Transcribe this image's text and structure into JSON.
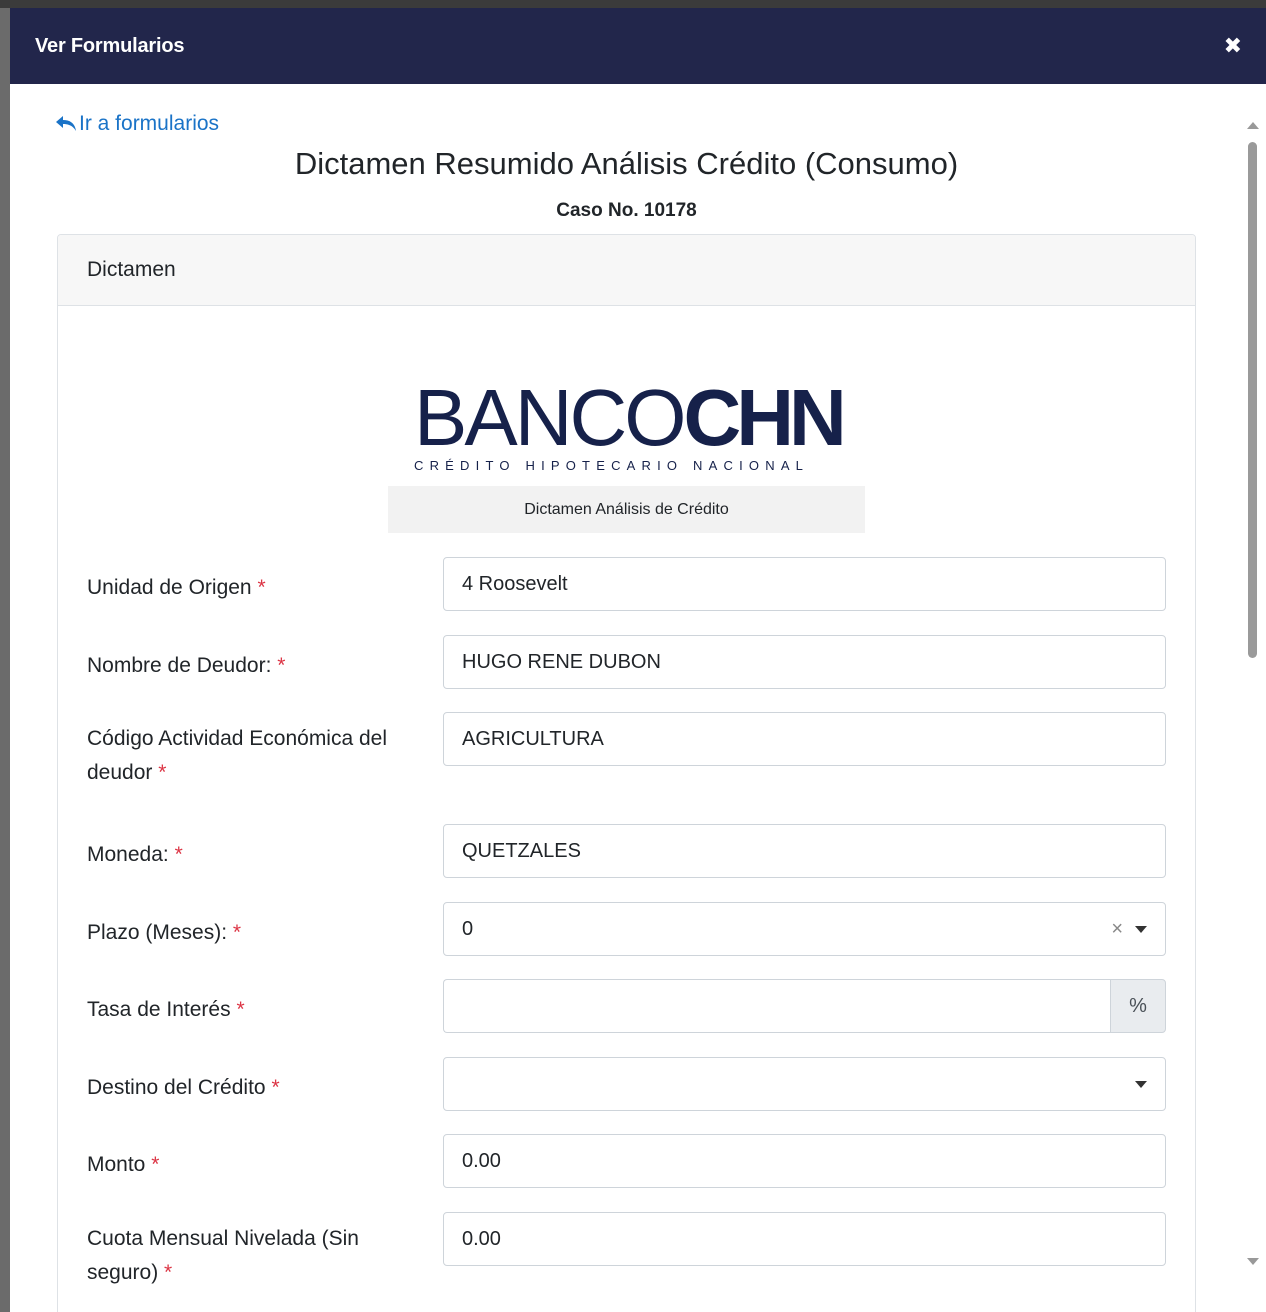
{
  "modal": {
    "title": "Ver Formularios",
    "close_symbol": "✖"
  },
  "back_link": {
    "label": "Ir a formularios",
    "icon": "reply-arrow-icon"
  },
  "form": {
    "title": "Dictamen Resumido Análisis Crédito (Consumo)",
    "case_no": "Caso No. 10178"
  },
  "card": {
    "header": "Dictamen"
  },
  "logo": {
    "main_thin": "BANCO",
    "main_bold": "CHN",
    "tagline": "CRÉDITO HIPOTECARIO NACIONAL",
    "caption": "Dictamen Análisis de Crédito"
  },
  "required_mark": "*",
  "fields": {
    "unidad": {
      "label": "Unidad de Origen",
      "value": "4 Roosevelt"
    },
    "deudor": {
      "label": "Nombre de Deudor:",
      "value": "HUGO RENE DUBON"
    },
    "actividad": {
      "label": "Código Actividad Económica del deudor",
      "value": "AGRICULTURA"
    },
    "moneda": {
      "label": "Moneda:",
      "value": "QUETZALES"
    },
    "plazo": {
      "label": "Plazo (Meses):",
      "value": "0",
      "clear": "×"
    },
    "tasa": {
      "label": "Tasa de Interés",
      "value": "",
      "addon": "%"
    },
    "destino": {
      "label": "Destino del Crédito",
      "value": ""
    },
    "monto": {
      "label": "Monto",
      "value": "0.00"
    },
    "cuota": {
      "label": "Cuota Mensual Nivelada (Sin seguro)",
      "value": "0.00"
    }
  },
  "colors": {
    "header_bg": "#22264b",
    "link": "#1a73c7",
    "required": "#dc3545",
    "logo": "#16214a"
  }
}
